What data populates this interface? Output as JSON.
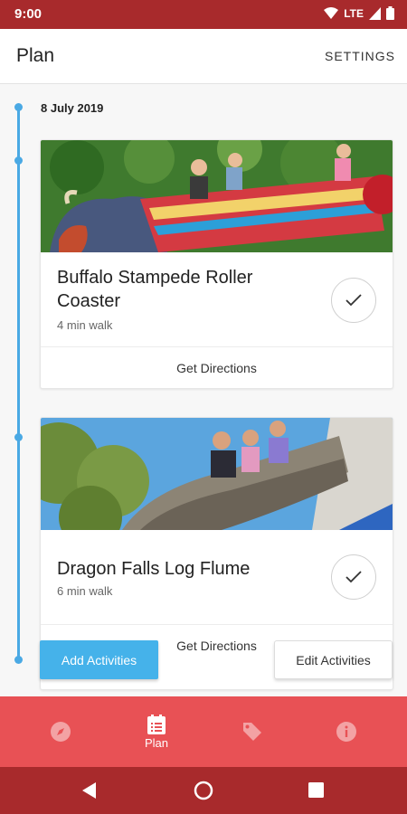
{
  "status_bar": {
    "time": "9:00",
    "network": "LTE"
  },
  "app_bar": {
    "title": "Plan",
    "settings_label": "SETTINGS"
  },
  "timeline": {
    "date": "8 July 2019"
  },
  "activities": [
    {
      "name_line1": "Buffalo Stampede Roller",
      "name_line2": "Coaster",
      "walk": "4 min walk",
      "directions_label": "Get Directions"
    },
    {
      "name": "Dragon Falls Log Flume",
      "walk": "6 min walk",
      "directions_label": "Get Directions"
    }
  ],
  "buttons": {
    "add_label": "Add Activities",
    "edit_label": "Edit Activities"
  },
  "bottom_nav": {
    "items": [
      {
        "icon": "compass-icon",
        "label": ""
      },
      {
        "icon": "calendar-list-icon",
        "label": "Plan"
      },
      {
        "icon": "tag-icon",
        "label": ""
      },
      {
        "icon": "info-icon",
        "label": ""
      }
    ],
    "active_index": 1
  },
  "colors": {
    "status_bar": "#a82a2c",
    "bottom_nav": "#e85155",
    "accent": "#45b2ea",
    "timeline": "#4aa9e4"
  }
}
